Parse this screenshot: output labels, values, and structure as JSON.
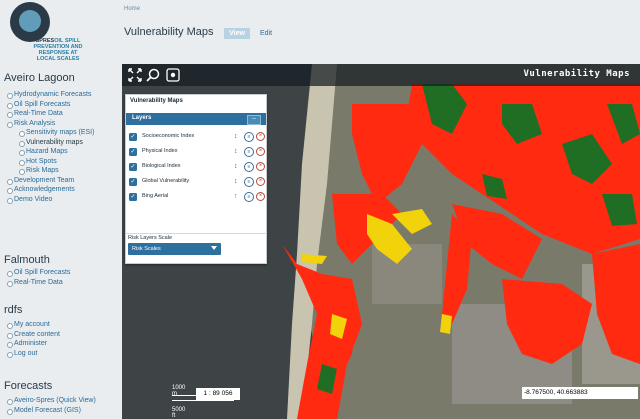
{
  "logo": {
    "brand": "SPRES",
    "tagline": [
      "OIL SPILL",
      "PREVENTION AND",
      "RESPONSE AT",
      "LOCAL SCALES"
    ]
  },
  "sidebar": {
    "aveiro": {
      "title": "Aveiro Lagoon",
      "items": [
        {
          "label": "Hydrodynamic Forecasts",
          "level": 1
        },
        {
          "label": "Oil Spill Forecasts",
          "level": 1
        },
        {
          "label": "Real-Time Data",
          "level": 1
        },
        {
          "label": "Risk Analysis",
          "level": 1
        },
        {
          "label": "Sensitivity maps (ESI)",
          "level": 2
        },
        {
          "label": "Vulnerability maps",
          "level": 2
        },
        {
          "label": "Hazard Maps",
          "level": 2
        },
        {
          "label": "Hot Spots",
          "level": 2
        },
        {
          "label": "Risk Maps",
          "level": 2
        },
        {
          "label": "Development Team",
          "level": 1
        },
        {
          "label": "Acknowledgements",
          "level": 1
        },
        {
          "label": "Demo Video",
          "level": 1
        }
      ]
    },
    "falmouth": {
      "title": "Falmouth",
      "items": [
        {
          "label": "Oil Spill Forecasts"
        },
        {
          "label": "Real-Time Data"
        }
      ]
    },
    "rdfs": {
      "title": "rdfs",
      "items": [
        {
          "label": "My account"
        },
        {
          "label": "Create content"
        },
        {
          "label": "Administer"
        },
        {
          "label": "Log out"
        }
      ]
    },
    "forecasts": {
      "title": "Forecasts",
      "items": [
        {
          "label": "Aveiro-Spres (Quick View)"
        },
        {
          "label": "Model Forecast (GIS)"
        }
      ]
    }
  },
  "header": {
    "breadcrumb": "Home",
    "title": "Vulnerability Maps",
    "tab_view": "View",
    "tab_edit": "Edit"
  },
  "map": {
    "title": "Vulnerability Maps",
    "tools": [
      "expand-icon",
      "zoom-search-icon",
      "target-icon"
    ],
    "panel": {
      "title": "Vulnerability Maps",
      "layers_header": "Layers",
      "layers": [
        {
          "name": "Socioeconomic Index",
          "checked": true
        },
        {
          "name": "Physical Index",
          "checked": true
        },
        {
          "name": "Biological Index",
          "checked": true
        },
        {
          "name": "Global Vulnerability",
          "checked": true
        },
        {
          "name": "Bing Aerial",
          "checked": true
        }
      ],
      "scale_label": "Risk Layers Scale",
      "scale_select": "Risk Scales"
    },
    "scale_top": "1000 m",
    "scale_bottom": "5000 ft",
    "ratio": "1 : 89 056",
    "coords": "-8.767500, 40.663883",
    "colors": {
      "high": "#ff2a10",
      "medium": "#f2d20a",
      "low": "#1f6e24",
      "sea": "#3e4346"
    }
  }
}
